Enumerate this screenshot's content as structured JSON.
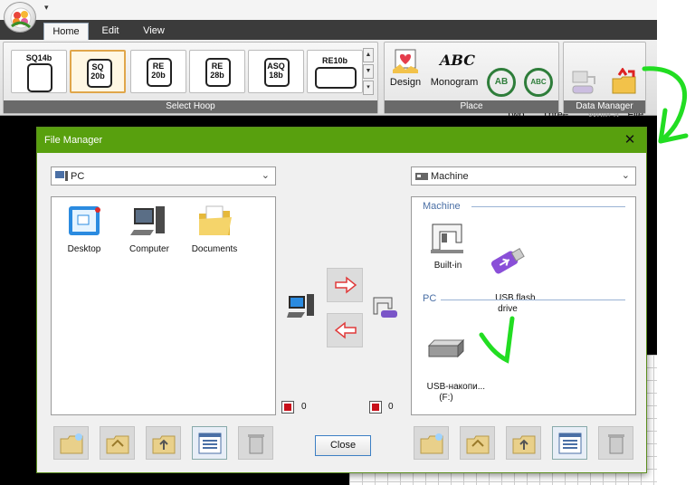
{
  "quick_access": {
    "arrow": "▾"
  },
  "tabs": [
    {
      "label": "Home",
      "active": true
    },
    {
      "label": "Edit",
      "active": false
    },
    {
      "label": "View",
      "active": false
    }
  ],
  "ribbon": {
    "select_hoop": {
      "label": "Select Hoop",
      "hoops": [
        {
          "label": "SQ14b"
        },
        {
          "label": "SQ\n20b",
          "selected": true
        },
        {
          "label": "RE\n20b"
        },
        {
          "label": "RE\n28b"
        },
        {
          "label": "ASQ\n18b"
        },
        {
          "label": "RE10b"
        }
      ]
    },
    "place": {
      "label": "Place",
      "buttons": [
        {
          "label": "Design",
          "icon": "design-icon"
        },
        {
          "label": "Monogram",
          "icon": "monogram-icon",
          "glyph": "ABC"
        },
        {
          "label": "Two\nLetters",
          "icon": "two-letters-icon",
          "glyph": "AB"
        },
        {
          "label": "Three\nLetters",
          "icon": "three-letters-icon",
          "glyph": "ABC"
        }
      ]
    },
    "data_manager": {
      "label": "Data Manager",
      "buttons": [
        {
          "label": "Write a\nDesign",
          "icon": "write-design-icon",
          "disabled": true
        },
        {
          "label": "File\nManager",
          "icon": "file-manager-icon",
          "disabled": false
        }
      ]
    }
  },
  "dialog": {
    "title": "File Manager",
    "close_glyph": "✕",
    "left": {
      "location": "PC",
      "items": [
        {
          "label": "Desktop",
          "icon": "desktop-icon"
        },
        {
          "label": "Computer",
          "icon": "computer-icon"
        },
        {
          "label": "Documents",
          "icon": "documents-folder-icon"
        }
      ],
      "selected_count": "0"
    },
    "right": {
      "location": "Machine",
      "sections": [
        {
          "label": "Machine",
          "items": [
            {
              "label": "Built-in",
              "icon": "sewing-machine-icon"
            },
            {
              "label": "USB flash\ndrive",
              "icon": "usb-flash-drive-icon"
            }
          ]
        },
        {
          "label": "PC",
          "items": [
            {
              "label": "USB-накопи...\n(F:)",
              "icon": "usb-drive-icon"
            }
          ]
        }
      ],
      "selected_count": "0"
    },
    "close_label": "Close"
  },
  "colors": {
    "dialog_title_bg": "#58a00e",
    "annotation": "#22dd22",
    "ribbon_group_label": "#6a6a6a",
    "selected_hoop": "#e0a64a"
  }
}
